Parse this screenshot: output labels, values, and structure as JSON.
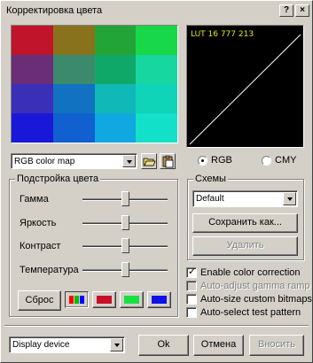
{
  "window": {
    "title": "Корректировка цвета",
    "help_button": "?",
    "close_button": "×"
  },
  "preview": {
    "grid": [
      [
        "#c0142a",
        "#88721c",
        "#23a436",
        "#18d84a"
      ],
      [
        "#6a2d78",
        "#3c8a6e",
        "#10a868",
        "#18d6a0"
      ],
      [
        "#3a30b8",
        "#1072c0",
        "#10b8b8",
        "#10d4b8"
      ],
      [
        "#1a18d8",
        "#1060d0",
        "#10a8e0",
        "#12e0c8"
      ]
    ]
  },
  "lut": {
    "label": "LUT 16 777 213",
    "text_color": "#e8e800"
  },
  "profile_select": {
    "value": "RGB color map"
  },
  "color_mode": {
    "rgb_label": "RGB",
    "cmy_label": "CMY",
    "selected": "RGB"
  },
  "adjust_group": {
    "title": "Подстройка цвета",
    "sliders": [
      {
        "label": "Гамма",
        "value": 0.5
      },
      {
        "label": "Яркость",
        "value": 0.5
      },
      {
        "label": "Контраст",
        "value": 0.5
      },
      {
        "label": "Температура",
        "value": 0.5
      }
    ],
    "reset_label": "Сброс",
    "channels": [
      {
        "name": "rgb",
        "color": "#ff0000"
      },
      {
        "name": "red",
        "color": "#c8102a"
      },
      {
        "name": "green",
        "color": "#18e040"
      },
      {
        "name": "blue",
        "color": "#1010e8"
      }
    ]
  },
  "schemes_group": {
    "title": "Схемы",
    "selected": "Default",
    "save_as_label": "Сохранить как...",
    "delete_label": "Удалить"
  },
  "options": [
    {
      "label": "Enable color correction",
      "checked": true,
      "enabled": true
    },
    {
      "label": "Auto-adjust gamma ramp",
      "checked": false,
      "enabled": false
    },
    {
      "label": "Auto-size custom bitmaps",
      "checked": false,
      "enabled": true
    },
    {
      "label": "Auto-select test pattern",
      "checked": false,
      "enabled": true
    }
  ],
  "footer": {
    "device_select": "Display device",
    "ok_label": "Ok",
    "cancel_label": "Отмена",
    "apply_label": "Вносить"
  }
}
